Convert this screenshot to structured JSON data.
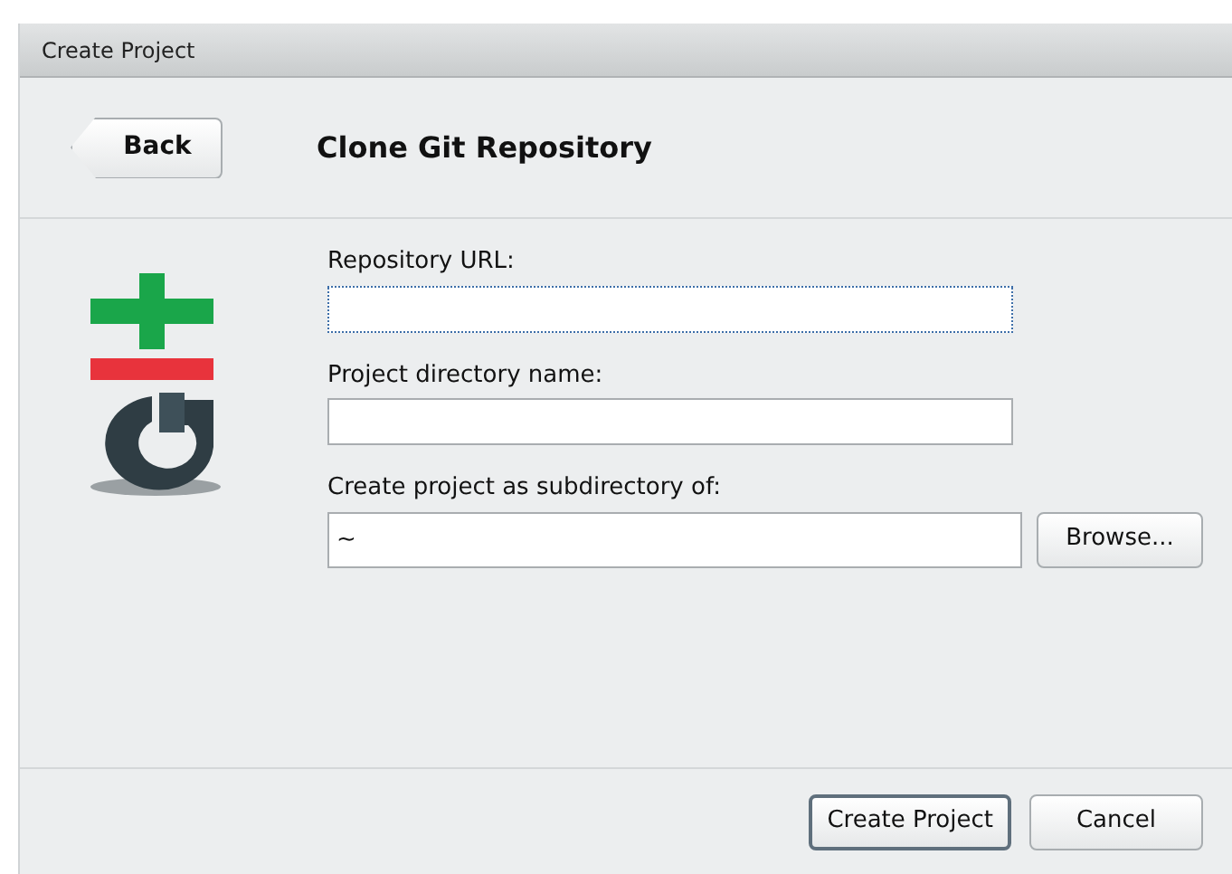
{
  "window": {
    "title": "Create Project"
  },
  "back_button": "Back",
  "heading": "Clone Git Repository",
  "fields": [
    {
      "label": "Repository URL:",
      "focused": true
    },
    {
      "label": "Project directory name:",
      "focused": false
    },
    {
      "label": "Create project as subdirectory of:",
      "value": "~",
      "focused": false,
      "button": "Browse..."
    }
  ],
  "buttons": [
    {
      "label": "Create Project",
      "default": true
    },
    {
      "label": "Cancel",
      "default": false
    }
  ]
}
